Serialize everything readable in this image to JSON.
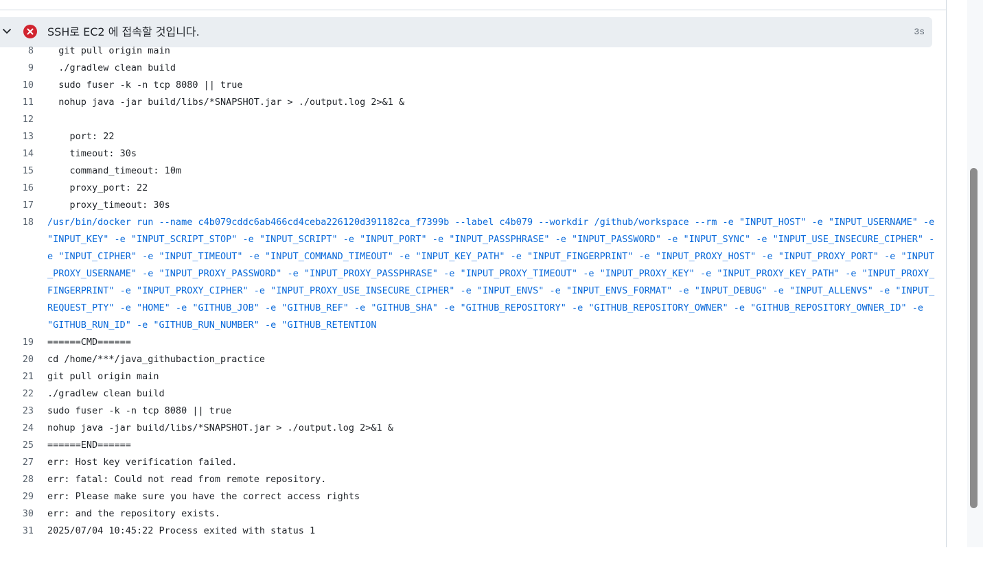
{
  "step": {
    "title": "SSH로 EC2 에 접속할 것입니다.",
    "duration": "3s",
    "status": "failed",
    "status_color": "#d1242f"
  },
  "log_lines": [
    {
      "num": "8",
      "text": "  git pull origin main",
      "kind": "plain"
    },
    {
      "num": "9",
      "text": "  ./gradlew clean build",
      "kind": "plain"
    },
    {
      "num": "10",
      "text": "  sudo fuser -k -n tcp 8080 || true",
      "kind": "plain"
    },
    {
      "num": "11",
      "text": "  nohup java -jar build/libs/*SNAPSHOT.jar > ./output.log 2>&1 &",
      "kind": "plain"
    },
    {
      "num": "12",
      "text": "",
      "kind": "plain"
    },
    {
      "num": "13",
      "text": "    port: 22",
      "kind": "plain"
    },
    {
      "num": "14",
      "text": "    timeout: 30s",
      "kind": "plain"
    },
    {
      "num": "15",
      "text": "    command_timeout: 10m",
      "kind": "plain"
    },
    {
      "num": "16",
      "text": "    proxy_port: 22",
      "kind": "plain"
    },
    {
      "num": "17",
      "text": "    proxy_timeout: 30s",
      "kind": "plain"
    },
    {
      "num": "18",
      "text": "/usr/bin/docker run --name c4b079cddc6ab466cd4ceba226120d391182ca_f7399b --label c4b079 --workdir /github/workspace --rm -e \"INPUT_HOST\" -e \"INPUT_USERNAME\" -e \"INPUT_KEY\" -e \"INPUT_SCRIPT_STOP\" -e \"INPUT_SCRIPT\" -e \"INPUT_PORT\" -e \"INPUT_PASSPHRASE\" -e \"INPUT_PASSWORD\" -e \"INPUT_SYNC\" -e \"INPUT_USE_INSECURE_CIPHER\" -e \"INPUT_CIPHER\" -e \"INPUT_TIMEOUT\" -e \"INPUT_COMMAND_TIMEOUT\" -e \"INPUT_KEY_PATH\" -e \"INPUT_FINGERPRINT\" -e \"INPUT_PROXY_HOST\" -e \"INPUT_PROXY_PORT\" -e \"INPUT_PROXY_USERNAME\" -e \"INPUT_PROXY_PASSWORD\" -e \"INPUT_PROXY_PASSPHRASE\" -e \"INPUT_PROXY_TIMEOUT\" -e \"INPUT_PROXY_KEY\" -e \"INPUT_PROXY_KEY_PATH\" -e \"INPUT_PROXY_FINGERPRINT\" -e \"INPUT_PROXY_CIPHER\" -e \"INPUT_PROXY_USE_INSECURE_CIPHER\" -e \"INPUT_ENVS\" -e \"INPUT_ENVS_FORMAT\" -e \"INPUT_DEBUG\" -e \"INPUT_ALLENVS\" -e \"INPUT_REQUEST_PTY\" -e \"HOME\" -e \"GITHUB_JOB\" -e \"GITHUB_REF\" -e \"GITHUB_SHA\" -e \"GITHUB_REPOSITORY\" -e \"GITHUB_REPOSITORY_OWNER\" -e \"GITHUB_REPOSITORY_OWNER_ID\" -e \"GITHUB_RUN_ID\" -e \"GITHUB_RUN_NUMBER\" -e \"GITHUB_RETENTION",
      "kind": "cmd"
    },
    {
      "num": "19",
      "text": "======CMD======",
      "kind": "plain"
    },
    {
      "num": "20",
      "text": "cd /home/***/java_githubaction_practice",
      "kind": "plain"
    },
    {
      "num": "21",
      "text": "git pull origin main",
      "kind": "plain"
    },
    {
      "num": "22",
      "text": "./gradlew clean build",
      "kind": "plain"
    },
    {
      "num": "23",
      "text": "sudo fuser -k -n tcp 8080 || true",
      "kind": "plain"
    },
    {
      "num": "24",
      "text": "nohup java -jar build/libs/*SNAPSHOT.jar > ./output.log 2>&1 &",
      "kind": "plain"
    },
    {
      "num": "25",
      "text": "======END======",
      "kind": "plain"
    },
    {
      "num": "27",
      "text": "err: Host key verification failed.",
      "kind": "plain"
    },
    {
      "num": "28",
      "text": "err: fatal: Could not read from remote repository.",
      "kind": "plain"
    },
    {
      "num": "29",
      "text": "err: Please make sure you have the correct access rights",
      "kind": "plain"
    },
    {
      "num": "30",
      "text": "err: and the repository exists.",
      "kind": "plain"
    },
    {
      "num": "31",
      "text": "2025/07/04 10:45:22 Process exited with status 1",
      "kind": "plain"
    }
  ],
  "icons": {
    "chevron": "chevron-down-icon",
    "status": "x-circle-fill-icon"
  }
}
